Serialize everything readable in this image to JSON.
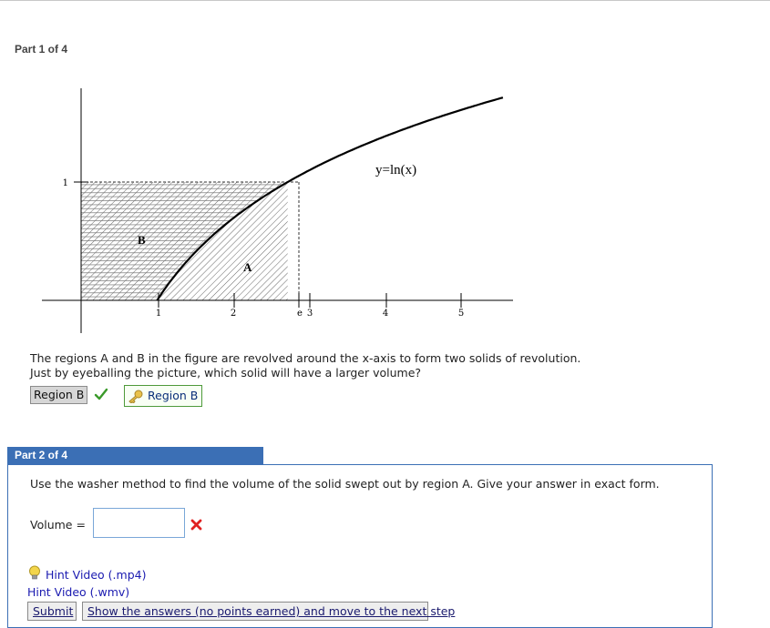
{
  "part1": {
    "title": "Part 1 of 4",
    "figure": {
      "curve_label": "y=ln(x)",
      "region_a_label": "A",
      "region_b_label": "B",
      "y_tick_label": "1",
      "x_tick_labels": [
        "1",
        "2",
        "e",
        "3",
        "4",
        "5"
      ]
    },
    "question_line1": "The regions A and B in the figure are revolved around the x-axis to form two solids of revolution.",
    "question_line2": "Just by eyeballing the picture, which solid will have a larger volume?",
    "given_answer": "Region B",
    "correct_answer": "Region B"
  },
  "part2": {
    "title": "Part 2 of 4",
    "question": "Use the washer method to find the volume of the solid swept out by region A. Give your answer in exact form.",
    "volume_label": "Volume =",
    "volume_value": "",
    "hint_mp4": "Hint Video (.mp4)",
    "hint_wmv": "Hint Video (.wmv)",
    "submit_label": "Submit",
    "show_answers_label": "Show the answers (no points earned) and move to the next step"
  },
  "colors": {
    "part_header": "#3b6fb5",
    "link": "#1a1ab0",
    "correct_border": "#4e9a3a",
    "wrong_mark": "#e02020"
  },
  "icons": [
    "check-icon",
    "key-icon",
    "x-icon",
    "lightbulb-icon"
  ]
}
